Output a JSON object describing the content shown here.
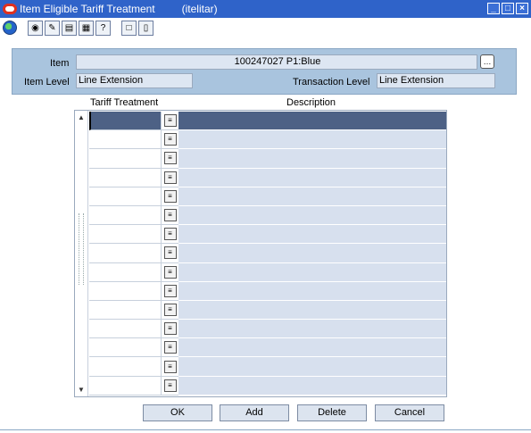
{
  "window": {
    "title": "Item Eligible Tariff Treatment",
    "user": "(itelitar)",
    "controls": [
      "_",
      "□",
      "×"
    ]
  },
  "toolbar": {
    "buttons": [
      "◉",
      "✎",
      "▤",
      "▦",
      "?",
      "□"
    ]
  },
  "header": {
    "item_label": "Item",
    "item_value": "100247027 P1:Blue",
    "item_level_label": "Item Level",
    "item_level_value": "Line Extension",
    "transaction_level_label": "Transaction Level",
    "transaction_level_value": "Line Extension"
  },
  "table": {
    "columns": [
      "Tariff Treatment",
      "Description"
    ],
    "row_count": 15,
    "selected_row": 0
  },
  "buttons": {
    "ok": "OK",
    "add": "Add",
    "delete": "Delete",
    "cancel": "Cancel"
  }
}
